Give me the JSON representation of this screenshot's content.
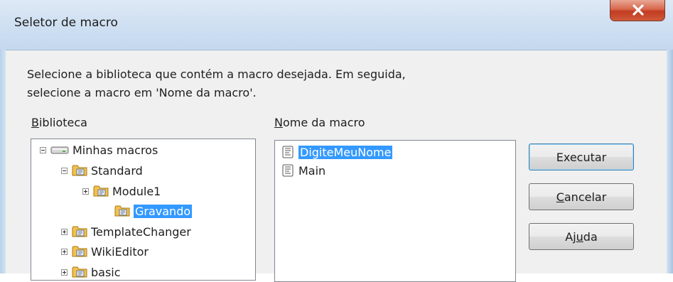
{
  "window": {
    "title": "Seletor de macro",
    "close_icon": "close-icon"
  },
  "instructions": {
    "line1": "Selecione a biblioteca que contém a macro desejada. Em seguida,",
    "line2": "selecione a macro em 'Nome da macro'."
  },
  "library": {
    "label_mnemonic": "B",
    "label_rest": "iblioteca",
    "tree": [
      {
        "label": "Minhas macros",
        "expander": "minus",
        "icon": "drive-icon",
        "selected": false
      },
      {
        "label": "Standard",
        "expander": "minus",
        "icon": "library-folder-icon",
        "selected": false
      },
      {
        "label": "Module1",
        "expander": "plus",
        "icon": "library-folder-icon",
        "selected": false
      },
      {
        "label": "Gravando",
        "expander": "none",
        "icon": "library-folder-icon",
        "selected": true
      },
      {
        "label": "TemplateChanger",
        "expander": "plus",
        "icon": "library-folder-icon",
        "selected": false
      },
      {
        "label": "WikiEditor",
        "expander": "plus",
        "icon": "library-folder-icon",
        "selected": false
      },
      {
        "label": "basic",
        "expander": "plus",
        "icon": "library-folder-icon",
        "selected": false
      }
    ]
  },
  "macro_list": {
    "label_mnemonic": "N",
    "label_rest": "ome da macro",
    "items": [
      {
        "label": "DigiteMeuNome",
        "icon": "macro-script-icon",
        "selected": true
      },
      {
        "label": "Main",
        "icon": "macro-script-icon",
        "selected": false
      }
    ]
  },
  "buttons": {
    "run": {
      "label": "Executar"
    },
    "cancel": {
      "pre": "",
      "mnemonic": "C",
      "post": "ancelar"
    },
    "help": {
      "pre": "Aj",
      "mnemonic": "u",
      "post": "da"
    }
  },
  "colors": {
    "selection": "#3399ff",
    "dialog_bg": "#f0f0f0",
    "folder": "#f2c14e",
    "close_button": "#c8442a"
  }
}
